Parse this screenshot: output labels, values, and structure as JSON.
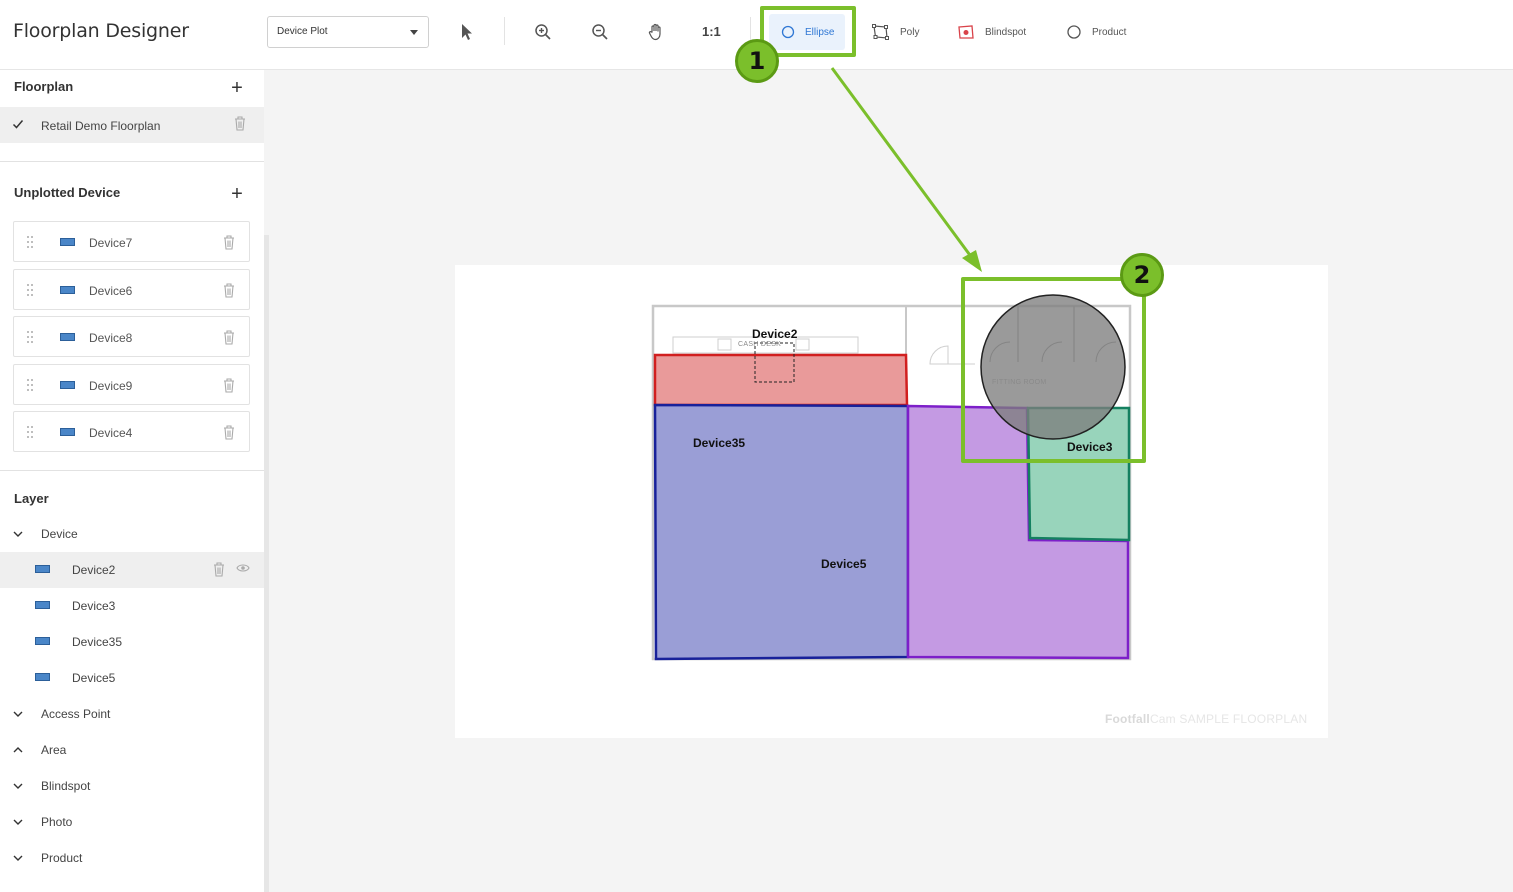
{
  "header": {
    "app_title": "Floorplan Designer",
    "mode_select": "Device Plot",
    "ratio_label": "1:1",
    "tools": {
      "ellipse": "Ellipse",
      "poly": "Poly",
      "blindspot": "Blindspot",
      "product": "Product"
    }
  },
  "sidebar": {
    "floorplan_title": "Floorplan",
    "floorplan_item": "Retail Demo Floorplan",
    "unplotted_title": "Unplotted Device",
    "unplotted": [
      "Device7",
      "Device6",
      "Device8",
      "Device9",
      "Device4"
    ],
    "layer_title": "Layer",
    "layer_device_group": "Device",
    "layer_devices": [
      "Device2",
      "Device3",
      "Device35",
      "Device5"
    ],
    "layer_groups": [
      "Access Point",
      "Area",
      "Blindspot",
      "Photo",
      "Product"
    ]
  },
  "canvas": {
    "labels": {
      "device2": "Device2",
      "device35": "Device35",
      "device5": "Device5",
      "device3": "Device3"
    },
    "plan_text": {
      "cash_desk": "CASH DESK",
      "fitting_room": "FITTING ROOM"
    },
    "watermark_brand_a": "Footfall",
    "watermark_brand_b": "Cam",
    "watermark_text": "SAMPLE FLOORPLAN"
  },
  "annotations": {
    "badge1": "1",
    "badge2": "2",
    "color": "#7bbf2b"
  },
  "colors": {
    "accent": "#2f77d4",
    "device2_fill": "#e99a9a",
    "device35_fill": "#9a9ed6",
    "device5_fill": "#c49ae3",
    "device3_fill": "#98d4bb"
  }
}
